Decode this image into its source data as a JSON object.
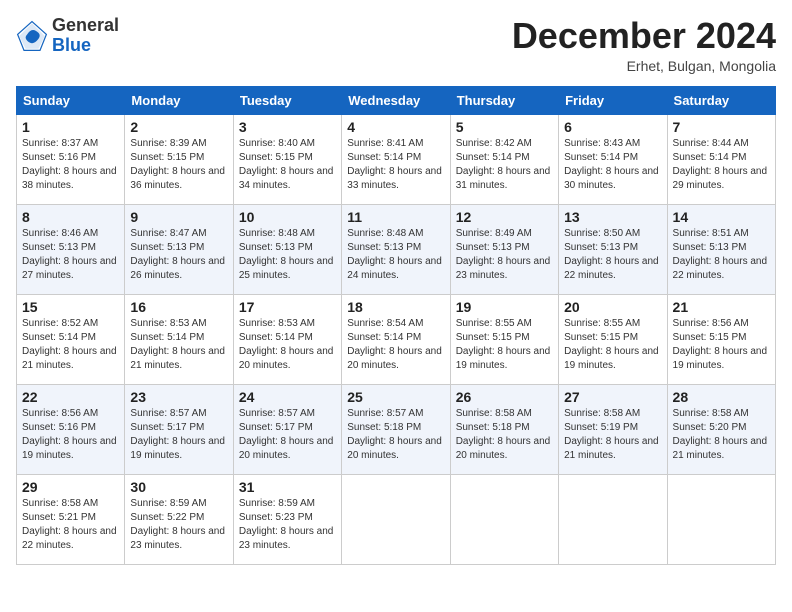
{
  "header": {
    "logo_general": "General",
    "logo_blue": "Blue",
    "month_title": "December 2024",
    "location": "Erhet, Bulgan, Mongolia"
  },
  "columns": [
    "Sunday",
    "Monday",
    "Tuesday",
    "Wednesday",
    "Thursday",
    "Friday",
    "Saturday"
  ],
  "weeks": [
    [
      {
        "day": "1",
        "sunrise": "Sunrise: 8:37 AM",
        "sunset": "Sunset: 5:16 PM",
        "daylight": "Daylight: 8 hours and 38 minutes."
      },
      {
        "day": "2",
        "sunrise": "Sunrise: 8:39 AM",
        "sunset": "Sunset: 5:15 PM",
        "daylight": "Daylight: 8 hours and 36 minutes."
      },
      {
        "day": "3",
        "sunrise": "Sunrise: 8:40 AM",
        "sunset": "Sunset: 5:15 PM",
        "daylight": "Daylight: 8 hours and 34 minutes."
      },
      {
        "day": "4",
        "sunrise": "Sunrise: 8:41 AM",
        "sunset": "Sunset: 5:14 PM",
        "daylight": "Daylight: 8 hours and 33 minutes."
      },
      {
        "day": "5",
        "sunrise": "Sunrise: 8:42 AM",
        "sunset": "Sunset: 5:14 PM",
        "daylight": "Daylight: 8 hours and 31 minutes."
      },
      {
        "day": "6",
        "sunrise": "Sunrise: 8:43 AM",
        "sunset": "Sunset: 5:14 PM",
        "daylight": "Daylight: 8 hours and 30 minutes."
      },
      {
        "day": "7",
        "sunrise": "Sunrise: 8:44 AM",
        "sunset": "Sunset: 5:14 PM",
        "daylight": "Daylight: 8 hours and 29 minutes."
      }
    ],
    [
      {
        "day": "8",
        "sunrise": "Sunrise: 8:46 AM",
        "sunset": "Sunset: 5:13 PM",
        "daylight": "Daylight: 8 hours and 27 minutes."
      },
      {
        "day": "9",
        "sunrise": "Sunrise: 8:47 AM",
        "sunset": "Sunset: 5:13 PM",
        "daylight": "Daylight: 8 hours and 26 minutes."
      },
      {
        "day": "10",
        "sunrise": "Sunrise: 8:48 AM",
        "sunset": "Sunset: 5:13 PM",
        "daylight": "Daylight: 8 hours and 25 minutes."
      },
      {
        "day": "11",
        "sunrise": "Sunrise: 8:48 AM",
        "sunset": "Sunset: 5:13 PM",
        "daylight": "Daylight: 8 hours and 24 minutes."
      },
      {
        "day": "12",
        "sunrise": "Sunrise: 8:49 AM",
        "sunset": "Sunset: 5:13 PM",
        "daylight": "Daylight: 8 hours and 23 minutes."
      },
      {
        "day": "13",
        "sunrise": "Sunrise: 8:50 AM",
        "sunset": "Sunset: 5:13 PM",
        "daylight": "Daylight: 8 hours and 22 minutes."
      },
      {
        "day": "14",
        "sunrise": "Sunrise: 8:51 AM",
        "sunset": "Sunset: 5:13 PM",
        "daylight": "Daylight: 8 hours and 22 minutes."
      }
    ],
    [
      {
        "day": "15",
        "sunrise": "Sunrise: 8:52 AM",
        "sunset": "Sunset: 5:14 PM",
        "daylight": "Daylight: 8 hours and 21 minutes."
      },
      {
        "day": "16",
        "sunrise": "Sunrise: 8:53 AM",
        "sunset": "Sunset: 5:14 PM",
        "daylight": "Daylight: 8 hours and 21 minutes."
      },
      {
        "day": "17",
        "sunrise": "Sunrise: 8:53 AM",
        "sunset": "Sunset: 5:14 PM",
        "daylight": "Daylight: 8 hours and 20 minutes."
      },
      {
        "day": "18",
        "sunrise": "Sunrise: 8:54 AM",
        "sunset": "Sunset: 5:14 PM",
        "daylight": "Daylight: 8 hours and 20 minutes."
      },
      {
        "day": "19",
        "sunrise": "Sunrise: 8:55 AM",
        "sunset": "Sunset: 5:15 PM",
        "daylight": "Daylight: 8 hours and 19 minutes."
      },
      {
        "day": "20",
        "sunrise": "Sunrise: 8:55 AM",
        "sunset": "Sunset: 5:15 PM",
        "daylight": "Daylight: 8 hours and 19 minutes."
      },
      {
        "day": "21",
        "sunrise": "Sunrise: 8:56 AM",
        "sunset": "Sunset: 5:15 PM",
        "daylight": "Daylight: 8 hours and 19 minutes."
      }
    ],
    [
      {
        "day": "22",
        "sunrise": "Sunrise: 8:56 AM",
        "sunset": "Sunset: 5:16 PM",
        "daylight": "Daylight: 8 hours and 19 minutes."
      },
      {
        "day": "23",
        "sunrise": "Sunrise: 8:57 AM",
        "sunset": "Sunset: 5:17 PM",
        "daylight": "Daylight: 8 hours and 19 minutes."
      },
      {
        "day": "24",
        "sunrise": "Sunrise: 8:57 AM",
        "sunset": "Sunset: 5:17 PM",
        "daylight": "Daylight: 8 hours and 20 minutes."
      },
      {
        "day": "25",
        "sunrise": "Sunrise: 8:57 AM",
        "sunset": "Sunset: 5:18 PM",
        "daylight": "Daylight: 8 hours and 20 minutes."
      },
      {
        "day": "26",
        "sunrise": "Sunrise: 8:58 AM",
        "sunset": "Sunset: 5:18 PM",
        "daylight": "Daylight: 8 hours and 20 minutes."
      },
      {
        "day": "27",
        "sunrise": "Sunrise: 8:58 AM",
        "sunset": "Sunset: 5:19 PM",
        "daylight": "Daylight: 8 hours and 21 minutes."
      },
      {
        "day": "28",
        "sunrise": "Sunrise: 8:58 AM",
        "sunset": "Sunset: 5:20 PM",
        "daylight": "Daylight: 8 hours and 21 minutes."
      }
    ],
    [
      {
        "day": "29",
        "sunrise": "Sunrise: 8:58 AM",
        "sunset": "Sunset: 5:21 PM",
        "daylight": "Daylight: 8 hours and 22 minutes."
      },
      {
        "day": "30",
        "sunrise": "Sunrise: 8:59 AM",
        "sunset": "Sunset: 5:22 PM",
        "daylight": "Daylight: 8 hours and 23 minutes."
      },
      {
        "day": "31",
        "sunrise": "Sunrise: 8:59 AM",
        "sunset": "Sunset: 5:23 PM",
        "daylight": "Daylight: 8 hours and 23 minutes."
      },
      null,
      null,
      null,
      null
    ]
  ]
}
